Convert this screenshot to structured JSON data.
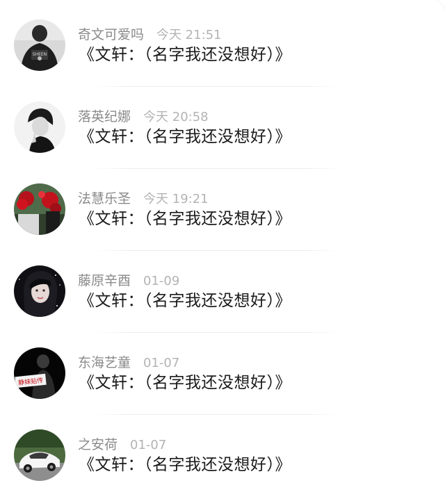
{
  "comments": [
    {
      "name": "奇文可爱吗",
      "time": "今天 21:51",
      "message": "《文轩：（名字我还没想好）》",
      "avatar": "avatar-dark-hoodie"
    },
    {
      "name": "落英纪娜",
      "time": "今天 20:58",
      "message": "《文轩：（名字我还没想好）》",
      "avatar": "avatar-bw-portrait"
    },
    {
      "name": "法慧乐圣",
      "time": "今天 19:21",
      "message": "《文轩：（名字我还没想好）》",
      "avatar": "avatar-red-flowers"
    },
    {
      "name": "藤原辛酉",
      "time": "01-09",
      "message": "《文轩：（名字我还没想好）》",
      "avatar": "avatar-girl-sparkle"
    },
    {
      "name": "东海艺童",
      "time": "01-07",
      "message": "《文轩：（名字我还没想好）》",
      "avatar": "avatar-black-redsign"
    },
    {
      "name": "之安荷",
      "time": "01-07",
      "message": "《文轩：（名字我还没想好）》",
      "avatar": "avatar-white-car"
    }
  ],
  "avatar_sign_text": "静妹贴传",
  "colors": {
    "name": "#8a8a8a",
    "time": "#b3b3b3",
    "message": "#1b1b1b",
    "divider": "#ececec"
  }
}
